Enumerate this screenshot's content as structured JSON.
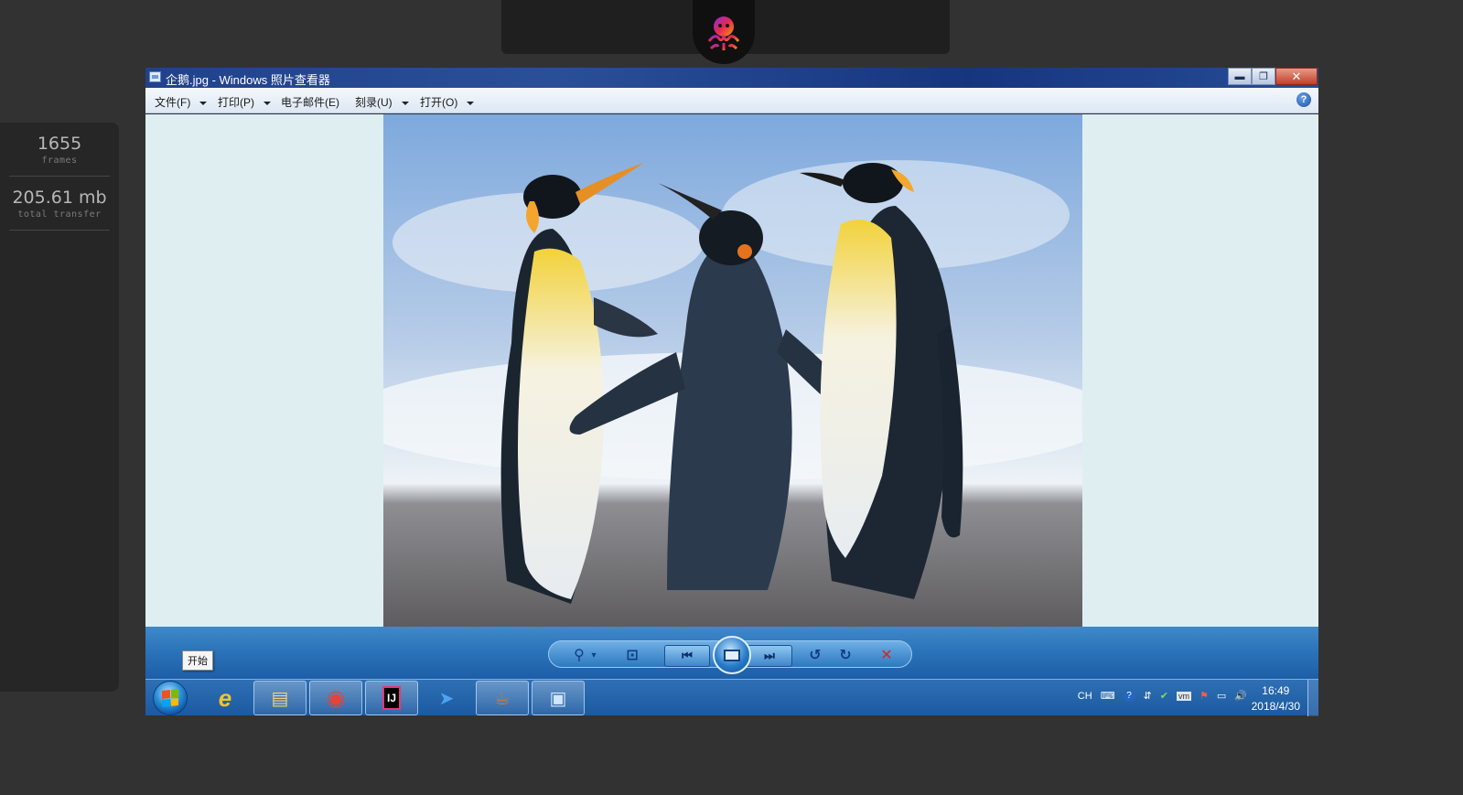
{
  "stats": [
    {
      "value": "1655",
      "label": "frames"
    },
    {
      "value": "205.61 mb",
      "label": "total transfer"
    }
  ],
  "window": {
    "title": "企鹅.jpg - Windows 照片查看器",
    "caption": {
      "minimize": "▬",
      "maximize": "❐",
      "close": "✕"
    }
  },
  "menu": [
    {
      "label": "文件(F)",
      "dropdown": true
    },
    {
      "label": "打印(P)",
      "dropdown": true
    },
    {
      "label": "电子邮件(E)",
      "dropdown": false
    },
    {
      "label": "刻录(U)",
      "dropdown": true
    },
    {
      "label": "打开(O)",
      "dropdown": true
    }
  ],
  "help": "?",
  "start_tooltip": "开始",
  "controls": {
    "zoom": "⚲",
    "zoom_caret": "▾",
    "fit": "⊡",
    "prev": "⏮",
    "next": "⏭",
    "rotate_ccw": "↺",
    "rotate_cw": "↻",
    "delete": "✕"
  },
  "taskbar": {
    "apps": [
      {
        "icon": "internet-explorer-icon",
        "glyph": "e",
        "color": "#f2c230"
      },
      {
        "icon": "file-explorer-icon",
        "glyph": "▤",
        "color": "#f4d27a"
      },
      {
        "icon": "chrome-icon",
        "glyph": "◉",
        "color": "#e54335"
      },
      {
        "icon": "intellij-icon",
        "glyph": "IJ",
        "color": "#ffffff"
      },
      {
        "icon": "feishu-bird-icon",
        "glyph": "➤",
        "color": "#4aa4f2"
      },
      {
        "icon": "java-icon",
        "glyph": "☕",
        "color": "#e0772c"
      },
      {
        "icon": "photo-viewer-icon",
        "glyph": "▣",
        "color": "#cfe6fb"
      }
    ],
    "tray": {
      "lang": "CH",
      "icons": [
        "keyboard-icon",
        "help-icon",
        "usb-icon",
        "security-icon",
        "vm-icon",
        "flag-alert-icon",
        "network-icon",
        "volume-icon"
      ],
      "glyphs": [
        "⌨",
        "?",
        "⇵",
        "✔",
        "vm",
        "⚑",
        "▭",
        "🔊"
      ]
    },
    "time": "16:49",
    "date": "2018/4/30"
  },
  "image": {
    "description": "企鹅.jpg"
  }
}
